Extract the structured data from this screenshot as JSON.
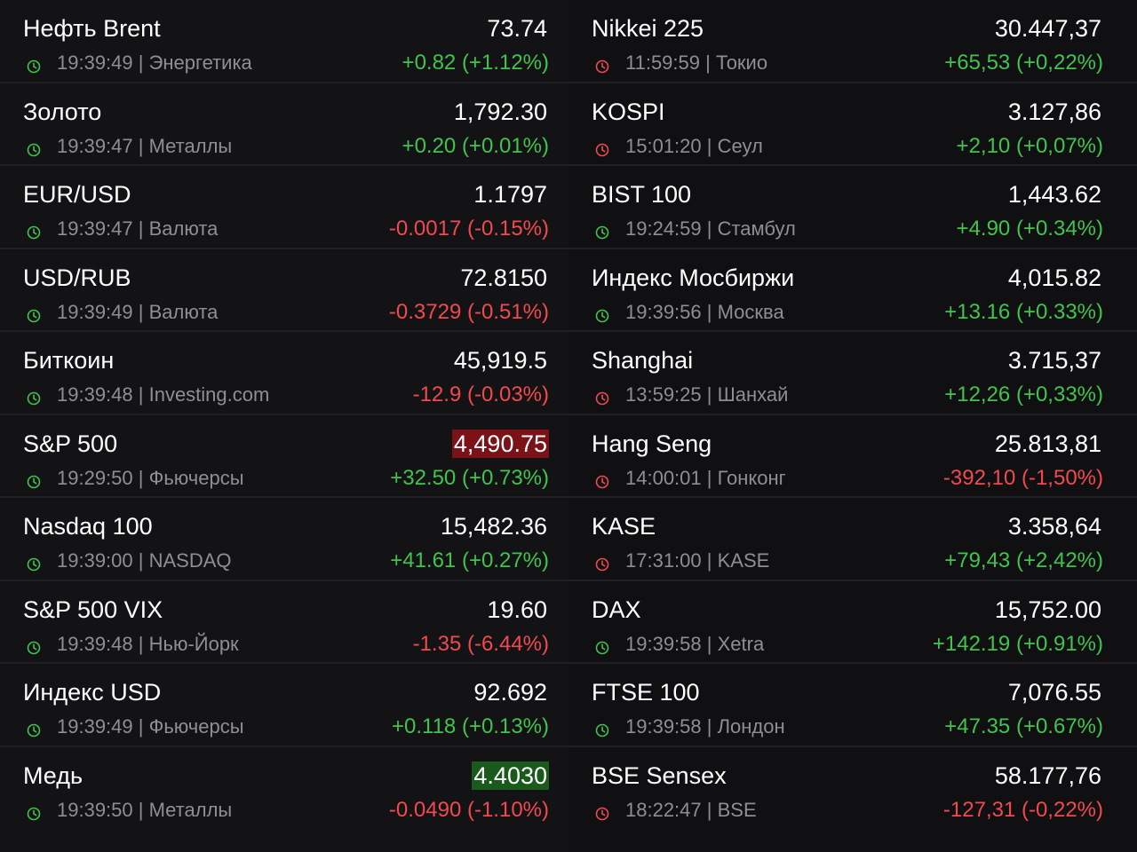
{
  "colors": {
    "up": "#41c34d",
    "down": "#f04a4f",
    "clock_open": "#41c34d",
    "clock_closed": "#f04a4f",
    "flash_red": "#7b1218",
    "flash_green": "#1a5a1c"
  },
  "left": [
    {
      "name": "Нефть Brent",
      "price": "73.74",
      "time": "19:39:49",
      "source": "Энергетика",
      "change": "+0.82 (+1.12%)",
      "dir": "up",
      "clock": "open",
      "flash": ""
    },
    {
      "name": "Золото",
      "price": "1,792.30",
      "time": "19:39:47",
      "source": "Металлы",
      "change": "+0.20 (+0.01%)",
      "dir": "up",
      "clock": "open",
      "flash": ""
    },
    {
      "name": "EUR/USD",
      "price": "1.1797",
      "time": "19:39:47",
      "source": "Валюта",
      "change": "-0.0017 (-0.15%)",
      "dir": "down",
      "clock": "open",
      "flash": ""
    },
    {
      "name": "USD/RUB",
      "price": "72.8150",
      "time": "19:39:49",
      "source": "Валюта",
      "change": "-0.3729 (-0.51%)",
      "dir": "down",
      "clock": "open",
      "flash": ""
    },
    {
      "name": "Биткоин",
      "price": "45,919.5",
      "time": "19:39:48",
      "source": "Investing.com",
      "change": "-12.9 (-0.03%)",
      "dir": "down",
      "clock": "open",
      "flash": ""
    },
    {
      "name": "S&P 500",
      "price": "4,490.75",
      "time": "19:29:50",
      "source": "Фьючерсы",
      "change": "+32.50 (+0.73%)",
      "dir": "up",
      "clock": "open",
      "flash": "red"
    },
    {
      "name": "Nasdaq 100",
      "price": "15,482.36",
      "time": "19:39:00",
      "source": "NASDAQ",
      "change": "+41.61 (+0.27%)",
      "dir": "up",
      "clock": "open",
      "flash": ""
    },
    {
      "name": "S&P 500 VIX",
      "price": "19.60",
      "time": "19:39:48",
      "source": "Нью-Йорк",
      "change": "-1.35 (-6.44%)",
      "dir": "down",
      "clock": "open",
      "flash": ""
    },
    {
      "name": "Индекс USD",
      "price": "92.692",
      "time": "19:39:49",
      "source": "Фьючерсы",
      "change": "+0.118 (+0.13%)",
      "dir": "up",
      "clock": "open",
      "flash": ""
    },
    {
      "name": "Медь",
      "price": "4.4030",
      "time": "19:39:50",
      "source": "Металлы",
      "change": "-0.0490 (-1.10%)",
      "dir": "down",
      "clock": "open",
      "flash": "green"
    }
  ],
  "right": [
    {
      "name": "Nikkei 225",
      "price": "30.447,37",
      "time": "11:59:59",
      "source": "Токио",
      "change": "+65,53 (+0,22%)",
      "dir": "up",
      "clock": "closed",
      "flash": ""
    },
    {
      "name": "KOSPI",
      "price": "3.127,86",
      "time": "15:01:20",
      "source": "Сеул",
      "change": "+2,10 (+0,07%)",
      "dir": "up",
      "clock": "closed",
      "flash": ""
    },
    {
      "name": "BIST 100",
      "price": "1,443.62",
      "time": "19:24:59",
      "source": "Стамбул",
      "change": "+4.90 (+0.34%)",
      "dir": "up",
      "clock": "open",
      "flash": ""
    },
    {
      "name": "Индекс Мосбиржи",
      "price": "4,015.82",
      "time": "19:39:56",
      "source": "Москва",
      "change": "+13.16 (+0.33%)",
      "dir": "up",
      "clock": "open",
      "flash": ""
    },
    {
      "name": "Shanghai",
      "price": "3.715,37",
      "time": "13:59:25",
      "source": "Шанхай",
      "change": "+12,26 (+0,33%)",
      "dir": "up",
      "clock": "closed",
      "flash": ""
    },
    {
      "name": "Hang Seng",
      "price": "25.813,81",
      "time": "14:00:01",
      "source": "Гонконг",
      "change": "-392,10 (-1,50%)",
      "dir": "down",
      "clock": "closed",
      "flash": ""
    },
    {
      "name": "KASE",
      "price": "3.358,64",
      "time": "17:31:00",
      "source": "KASE",
      "change": "+79,43 (+2,42%)",
      "dir": "up",
      "clock": "closed",
      "flash": ""
    },
    {
      "name": "DAX",
      "price": "15,752.00",
      "time": "19:39:58",
      "source": "Xetra",
      "change": "+142.19 (+0.91%)",
      "dir": "up",
      "clock": "open",
      "flash": ""
    },
    {
      "name": "FTSE 100",
      "price": "7,076.55",
      "time": "19:39:58",
      "source": "Лондон",
      "change": "+47.35 (+0.67%)",
      "dir": "up",
      "clock": "open",
      "flash": ""
    },
    {
      "name": "BSE Sensex",
      "price": "58.177,76",
      "time": "18:22:47",
      "source": "BSE",
      "change": "-127,31 (-0,22%)",
      "dir": "down",
      "clock": "closed",
      "flash": ""
    }
  ]
}
